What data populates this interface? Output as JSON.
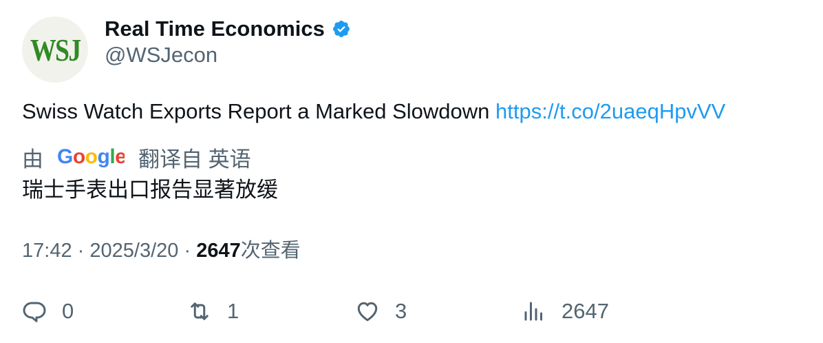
{
  "author": {
    "name": "Real Time Economics",
    "handle": "@WSJecon",
    "avatar_text": "WSJ",
    "verified": true
  },
  "tweet": {
    "text": "Swiss Watch Exports Report a Marked Slowdown",
    "link": "https://t.co/2uaeqHpvVV"
  },
  "translation": {
    "prefix": "由",
    "provider_logo": "Google",
    "suffix": "翻译自 英语",
    "text": "瑞士手表出口报告显著放缓"
  },
  "meta": {
    "time": "17:42",
    "separator": "·",
    "date": "2025/3/20",
    "views_count": "2647",
    "views_label": "次查看"
  },
  "actions": {
    "reply_count": "0",
    "retweet_count": "1",
    "like_count": "3",
    "views_count": "2647"
  },
  "colors": {
    "link": "#1d9bf0",
    "secondary_text": "#536471",
    "primary_text": "#0f1419",
    "verified_badge": "#1d9bf0",
    "avatar_bg": "#f2f2ed",
    "avatar_text": "#2f8a24"
  },
  "icons": [
    "verified-badge-icon",
    "reply-icon",
    "retweet-icon",
    "like-icon",
    "views-icon"
  ]
}
